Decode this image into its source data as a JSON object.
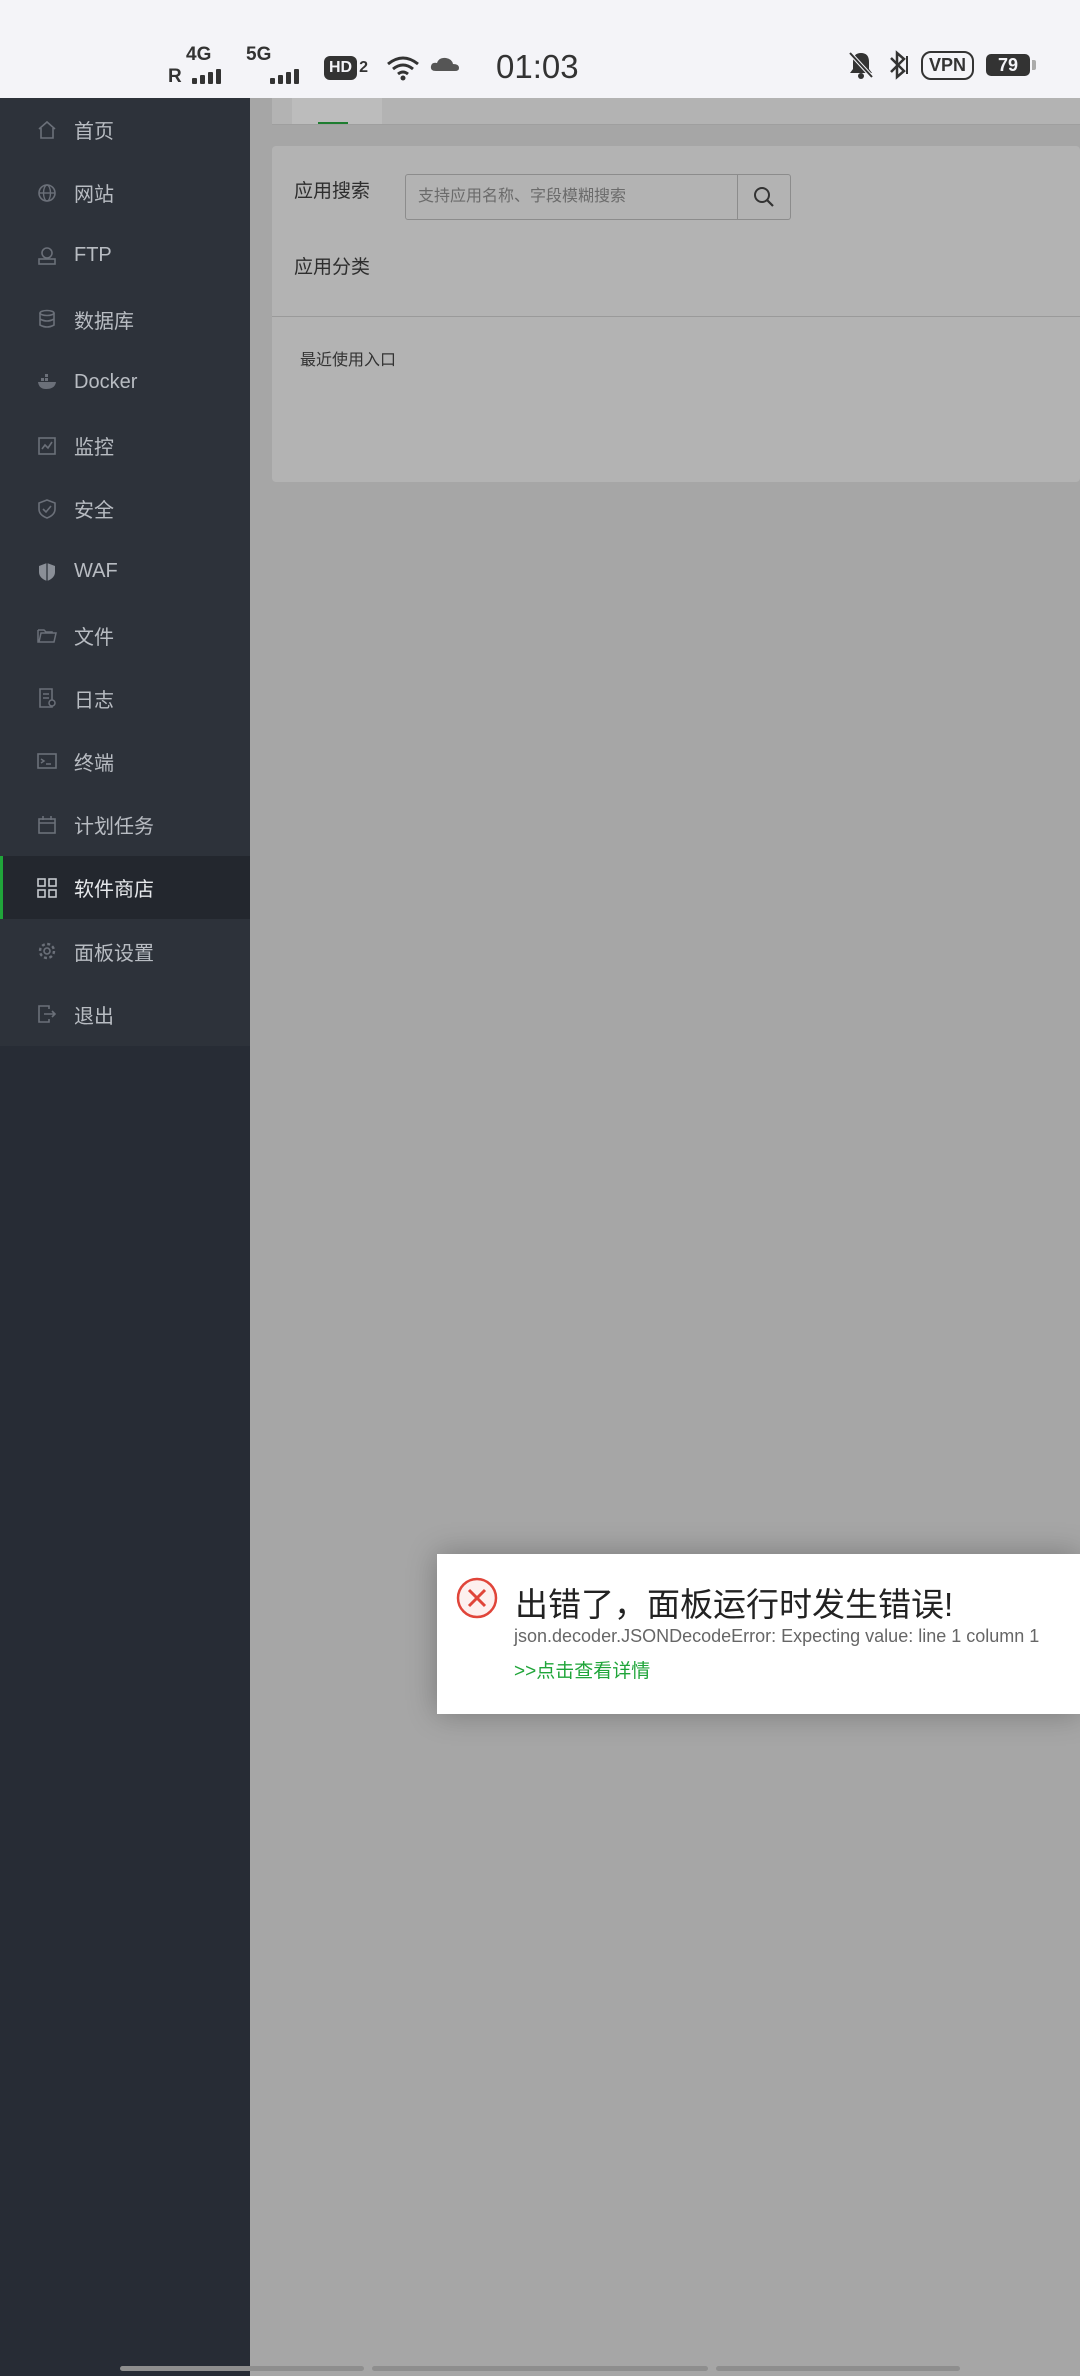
{
  "status_bar": {
    "net1_type": "4G",
    "net1_roaming": "R",
    "net2_type": "5G",
    "hd_label": "HD",
    "hd_sub": "2",
    "time": "01:03",
    "vpn_label": "VPN",
    "battery": "79"
  },
  "sidebar": {
    "items": [
      {
        "label": "首页",
        "icon": "home-icon"
      },
      {
        "label": "网站",
        "icon": "globe-icon"
      },
      {
        "label": "FTP",
        "icon": "ftp-icon"
      },
      {
        "label": "数据库",
        "icon": "database-icon"
      },
      {
        "label": "Docker",
        "icon": "docker-icon"
      },
      {
        "label": "监控",
        "icon": "monitor-icon"
      },
      {
        "label": "安全",
        "icon": "shield-icon"
      },
      {
        "label": "WAF",
        "icon": "waf-shield-icon"
      },
      {
        "label": "文件",
        "icon": "folder-icon"
      },
      {
        "label": "日志",
        "icon": "log-icon"
      },
      {
        "label": "终端",
        "icon": "terminal-icon"
      },
      {
        "label": "计划任务",
        "icon": "calendar-icon"
      },
      {
        "label": "软件商店",
        "icon": "apps-grid-icon",
        "active": true
      },
      {
        "label": "面板设置",
        "icon": "gear-icon"
      },
      {
        "label": "退出",
        "icon": "logout-icon"
      }
    ]
  },
  "main": {
    "search_label": "应用搜索",
    "search_placeholder": "支持应用名称、字段模糊搜索",
    "category_label": "应用分类",
    "recent_label": "最近使用入口"
  },
  "error_toast": {
    "title": "出错了，面板运行时发生错误!",
    "message": "json.decoder.JSONDecodeError: Expecting value: line 1 column 1",
    "link": ">>点击查看详情"
  },
  "colors": {
    "accent": "#20a53a",
    "sidebar_bg": "#272c35",
    "error_red": "#e0453a"
  }
}
